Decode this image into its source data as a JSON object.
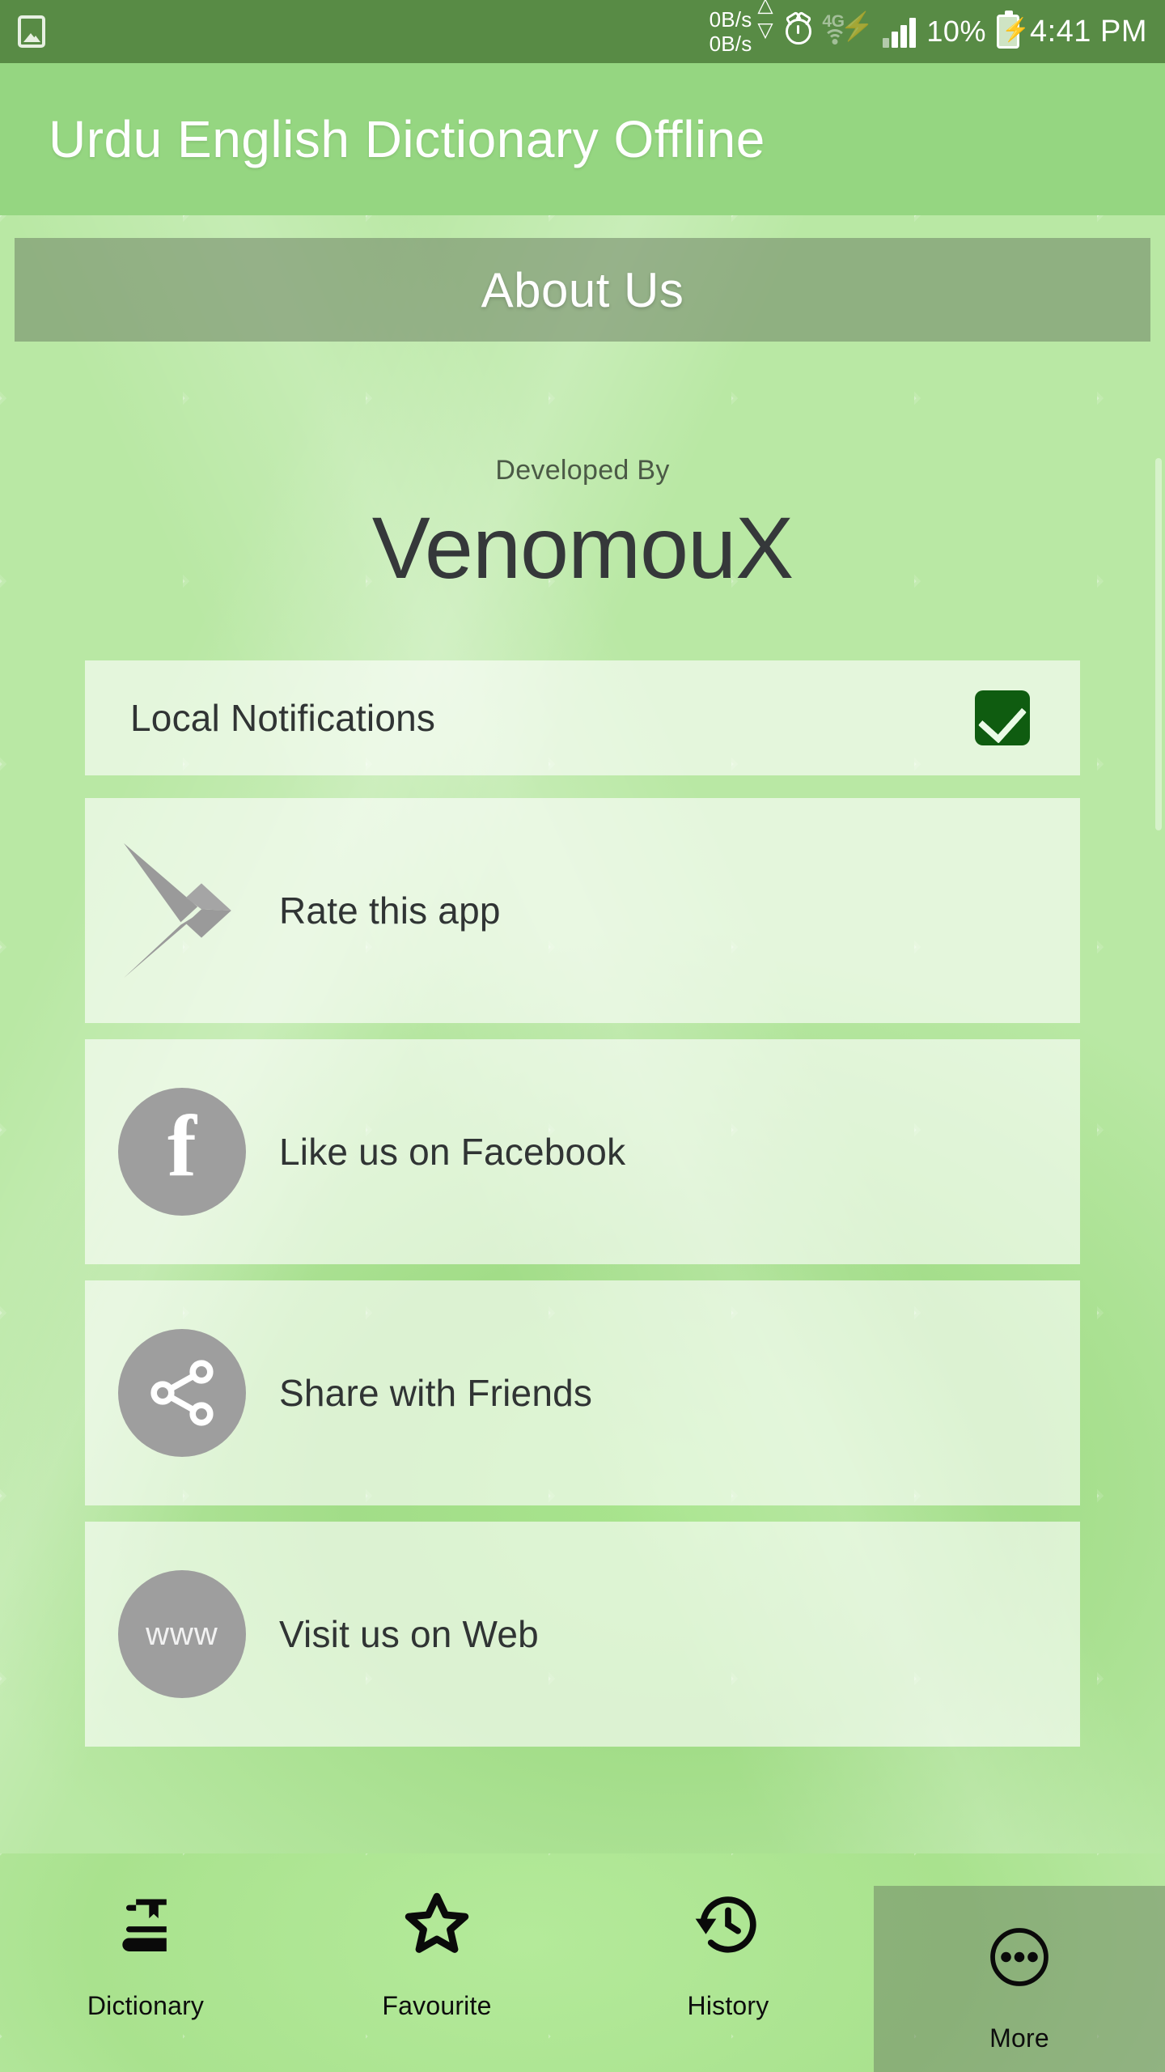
{
  "status_bar": {
    "gallery_icon": "gallery-icon",
    "net_up": "0B/s",
    "net_down": "0B/s",
    "alarm_icon": "alarm-icon",
    "network_type": "4G",
    "battery_percent": "10%",
    "time": "4:41 PM",
    "bg_color": "#588b45"
  },
  "app_bar": {
    "title": "Urdu English Dictionary Offline",
    "bg_color": "#95d681",
    "text_color": "#ffffff"
  },
  "screen": {
    "section_title": "About Us",
    "developed_by_label": "Developed By",
    "developer_name": "VenomouX"
  },
  "options": [
    {
      "label": "Local Notifications",
      "icon": "checkbox-icon",
      "checked": true
    },
    {
      "label": "Rate this app",
      "icon": "google-play-icon"
    },
    {
      "label": "Like us on Facebook",
      "icon": "facebook-icon",
      "glyph": "f"
    },
    {
      "label": "Share with Friends",
      "icon": "share-icon"
    },
    {
      "label": "Visit us on Web",
      "icon": "www-icon",
      "glyph": "www"
    }
  ],
  "bottom_nav": {
    "items": [
      {
        "label": "Dictionary",
        "icon": "book-icon",
        "active": false
      },
      {
        "label": "Favourite",
        "icon": "star-icon",
        "active": false
      },
      {
        "label": "History",
        "icon": "history-clock-icon",
        "active": false
      },
      {
        "label": "More",
        "icon": "more-dots-icon",
        "active": true
      }
    ]
  },
  "colors": {
    "accent_green": "#95d681",
    "status_green": "#588b45",
    "checkbox_green": "#0f5c10",
    "icon_gray": "#9e9e9e",
    "card_fill": "rgba(255,255,255,.62)"
  }
}
